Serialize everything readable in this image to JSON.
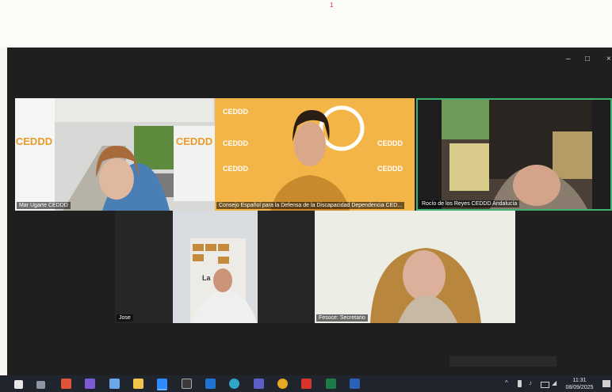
{
  "page": {
    "number": "1"
  },
  "window": {
    "minimize_glyph": "–",
    "maximize_glyph": "□",
    "close_glyph": "×"
  },
  "participants": [
    {
      "name": "Mar Ugarte CEDDD"
    },
    {
      "name": "Consejo Español para la Defensa de la Discapacidad Dependencia CED..."
    },
    {
      "name": "Rocío de los Reyes  CEDDD Andalucía"
    },
    {
      "name": "Jose"
    },
    {
      "name": "Fesoce: Secretario"
    }
  ],
  "backdrop": {
    "logo_text": "CEDDD",
    "small_logo_text": "CEDDD",
    "banner_text": "La"
  },
  "taskbar": {
    "icons": [
      "windows-start-icon",
      "task-view-icon",
      "app-icon",
      "video-app-icon",
      "chat-icon",
      "file-explorer-icon",
      "zoom-icon",
      "calculator-icon",
      "outlook-icon",
      "edge-icon",
      "teams-icon",
      "chrome-icon",
      "pdf-icon",
      "excel-icon",
      "word-icon"
    ],
    "time": "11:31",
    "date": "08/09/2025",
    "tray_caret": "^"
  },
  "colors": {
    "speaker_border": "#3cb371",
    "background_orange": "#f3b548"
  }
}
